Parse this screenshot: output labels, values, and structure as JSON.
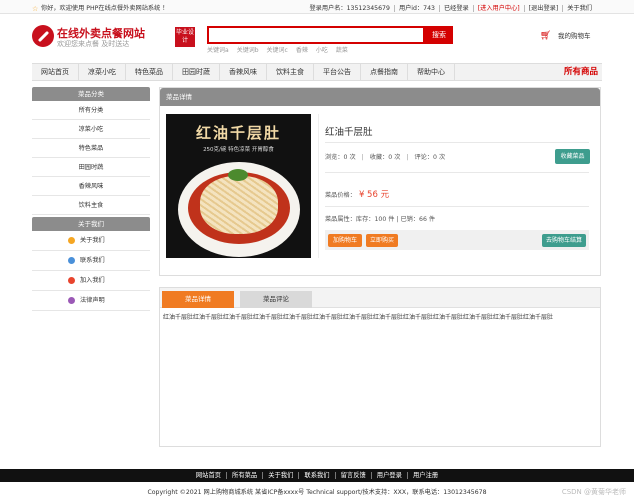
{
  "topbar": {
    "welcome": "你好，欢迎使用 PHP在线点餐外卖网站系统 ！",
    "login_user": "登录用户名：13512345679",
    "user_id": "用户id：743",
    "logged_in": "已经登录",
    "user_center": "[进入用户中心]",
    "logout": "[退出登录]",
    "about": "关于我们"
  },
  "logo": {
    "name": "在线外卖点餐网站",
    "slogan": "欢迎您来点餐 及时送达",
    "badge": "毕业设计"
  },
  "search": {
    "value": "",
    "button": "搜索",
    "keywords": [
      "关键词a",
      "关键词b",
      "关键词c",
      "香辣",
      "小吃",
      "蔬菜"
    ]
  },
  "cart": {
    "label": "我的购物车"
  },
  "nav": {
    "items": [
      "网站首页",
      "凉菜小吃",
      "特色菜品",
      "田园时蔬",
      "香辣风味",
      "饮料主食",
      "平台公告",
      "点餐指南",
      "帮助中心"
    ],
    "all": "所有商品"
  },
  "sidebar": {
    "category_title": "菜品分类",
    "categories": [
      "所有分类",
      "凉菜小吃",
      "特色菜品",
      "田园时蔬",
      "香辣风味",
      "饮料主食"
    ],
    "about_title": "关于我们",
    "about_items": [
      {
        "label": "关于我们",
        "icon": "info-icon",
        "color": "#f5a623"
      },
      {
        "label": "联系我们",
        "icon": "contact-icon",
        "color": "#4a90d9"
      },
      {
        "label": "加入我们",
        "icon": "join-icon",
        "color": "#e8442e"
      },
      {
        "label": "法律声明",
        "icon": "legal-icon",
        "color": "#9b59b6"
      }
    ]
  },
  "detail": {
    "header": "菜品详情",
    "photo_title": "红油千层肚",
    "photo_subtitle": "250克/碗 特色凉菜 开胃醇食",
    "name": "红油千层肚",
    "views": "浏览：0 次",
    "favorites": "收藏：0 次",
    "reviews": "评论：0 次",
    "fav_button": "收藏菜品",
    "price_label": "菜品价格：",
    "price": "¥ 56 元",
    "attrs": "菜品属性：库存：100 件 | 已销：66 件",
    "add_cart": "加购物车",
    "buy_now": "立即购买",
    "checkout": "去购物车结算"
  },
  "tabs": {
    "items": [
      "菜品详情",
      "菜品评论"
    ],
    "description": "红油千层肚红油千层肚红油千层肚红油千层肚红油千层肚红油千层肚红油千层肚红油千层肚红油千层肚红油千层肚红油千层肚红油千层肚红油千层肚"
  },
  "footer": {
    "links": [
      "网站首页",
      "所有菜品",
      "关于我们",
      "联系我们",
      "留言反馈",
      "用户登录",
      "用户注册"
    ],
    "copyright": "Copyright ©2021 网上购物商城系统 某省ICP备xxxx号 Technical support/技术支持：XXX，联系电话：13012345678",
    "watermark": "CSDN @黄菊华老师"
  },
  "colors": {
    "brand_red": "#c8101d",
    "accent_orange": "#f07b22",
    "teal": "#3e9d8e",
    "header_gray": "#8c8c8c"
  }
}
